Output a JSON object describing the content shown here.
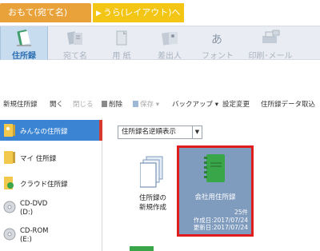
{
  "mode_tabs": {
    "front": "おもて(宛て名)",
    "switch": "うら(レイアウト)へ切替"
  },
  "ribbon": {
    "items": [
      {
        "label": "住所録",
        "icon": "address-book-icon",
        "active": true
      },
      {
        "label": "宛て名",
        "icon": "address-card-icon",
        "active": false
      },
      {
        "label": "用 紙",
        "icon": "paper-icon",
        "active": false
      },
      {
        "label": "差出人",
        "icon": "sender-icon",
        "active": false
      },
      {
        "label": "フォント",
        "icon": "font-icon",
        "active": false
      },
      {
        "label": "印刷･メール",
        "icon": "printer-icon",
        "active": false
      }
    ]
  },
  "toolbar": {
    "new": "新規住所録",
    "open": "開く",
    "close": "閉じる",
    "delete": "削除",
    "save": "保存",
    "save_arrow": "▾",
    "backup": "バックアップ",
    "backup_arrow": "▾",
    "settings": "設定変更",
    "import": "住所録データ取込"
  },
  "sidebar": {
    "items": [
      {
        "label": "みんなの住所録",
        "icon": "group-address-book-icon",
        "selected": true
      },
      {
        "label": "マイ 住所録",
        "icon": "my-address-book-icon",
        "selected": false
      },
      {
        "label": "クラウド住所録",
        "icon": "cloud-address-book-icon",
        "selected": false
      },
      {
        "label": "CD-DVD",
        "sub": "(D:)",
        "icon": "cd-dvd-drive-icon",
        "selected": false
      },
      {
        "label": "CD-ROM",
        "sub": "(E:)",
        "icon": "cd-rom-drive-icon",
        "selected": false
      }
    ]
  },
  "content": {
    "sort_label": "住所録名逆順表示",
    "new_card": {
      "line1": "住所録の",
      "line2": "新規作成"
    },
    "book_card": {
      "name": "会社用住所録",
      "count": "25件",
      "created": "作成日:2017/07/24",
      "updated": "更新日:2017/07/24"
    }
  },
  "colors": {
    "mode_front": "#e9a23a",
    "mode_switch": "#f3c515",
    "ribbon_active_text": "#2d6fb3",
    "sidebar_selected": "#3b84d3",
    "highlight_border": "#e01c1c",
    "book_card_bg": "#7f9bbd"
  }
}
